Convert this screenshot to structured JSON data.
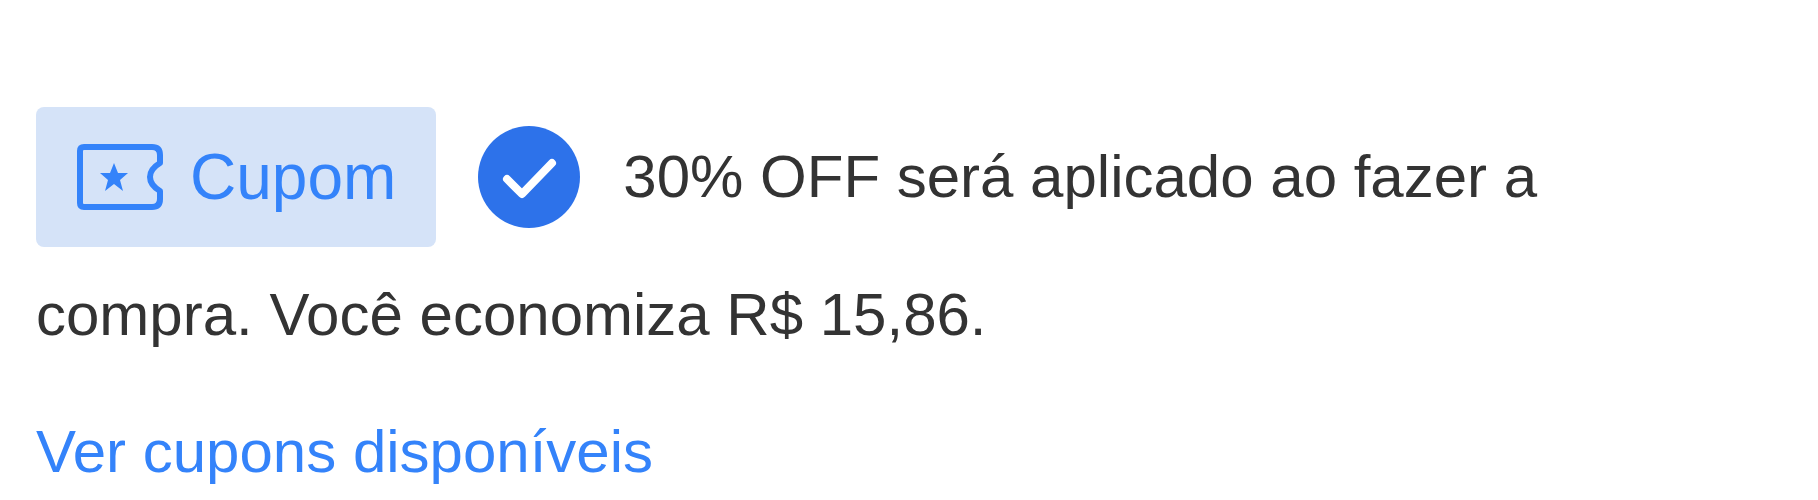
{
  "coupon": {
    "badge": "Cupom",
    "applied": true,
    "message_lines": [
      "30% OFF será aplicado ao fazer a",
      "compra. Você economiza R$ 15,86."
    ],
    "link": "Ver cupons disponíveis"
  }
}
